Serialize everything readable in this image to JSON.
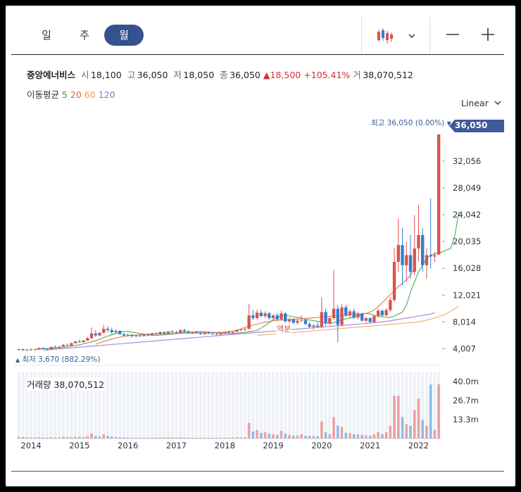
{
  "toolbar": {
    "periods": [
      {
        "label": "일",
        "active": false
      },
      {
        "label": "주",
        "active": false
      },
      {
        "label": "월",
        "active": true
      }
    ],
    "chart_style_icon": "candlestick-icon",
    "dropdown_icon": "chevron-down-icon",
    "zoom_out_label": "—",
    "zoom_in_label": "+"
  },
  "quote": {
    "name": "중앙에너비스",
    "open_label": "시",
    "open": "18,100",
    "high_label": "고",
    "high": "36,050",
    "low_label": "저",
    "low": "18,050",
    "close_label": "종",
    "close": "36,050",
    "change": "▲18,500",
    "change_pct": "+105.41%",
    "volume_label": "거",
    "volume": "38,070,512"
  },
  "ma_legend": {
    "label": "이동평균",
    "items": [
      {
        "period": "5",
        "color": "#2e9e3a"
      },
      {
        "period": "20",
        "color": "#e0603a"
      },
      {
        "period": "60",
        "color": "#e8a050"
      },
      {
        "period": "120",
        "color": "#9a6ad0"
      }
    ]
  },
  "scale": {
    "label": "Linear",
    "icon": "chevron-down-icon"
  },
  "annotations": {
    "high_marker": "최고 36,050 (0.00%)",
    "low_marker": "최저 3,670 (882.29%)",
    "current_price": "36,050",
    "event_label": "액분"
  },
  "volume_panel": {
    "label": "거래량 38,070,512"
  },
  "colors": {
    "up": "#d9534f",
    "down": "#2f7fd1",
    "accent": "#3f5a9a",
    "vol_up": "#eaa3a3",
    "vol_down": "#8fbce6"
  },
  "chart_data": {
    "type": "candlestick",
    "y_ticks": [
      "36,050",
      "32,056",
      "28,049",
      "24,042",
      "20,035",
      "16,028",
      "12,021",
      "8,014",
      "4,007"
    ],
    "ylim": [
      2700,
      37400
    ],
    "x_ticks": [
      "2014",
      "2015",
      "2016",
      "2017",
      "2018",
      "2019",
      "2020",
      "2021",
      "2022"
    ],
    "x_tick_pos": [
      3.5,
      15.5,
      27.5,
      39.5,
      51.5,
      63.5,
      75.5,
      87.5,
      99.5
    ],
    "volume_ticks": [
      "40.0m",
      "26.7m",
      "13.3m"
    ],
    "volume_max": 47000000,
    "candles": [
      [
        3900,
        4050,
        3700,
        3950,
        1200000
      ],
      [
        3950,
        4000,
        3700,
        3800,
        900000
      ],
      [
        3800,
        4000,
        3670,
        3900,
        800000
      ],
      [
        3900,
        4100,
        3800,
        3850,
        700000
      ],
      [
        3850,
        4000,
        3750,
        3950,
        600000
      ],
      [
        3950,
        4200,
        3900,
        4150,
        900000
      ],
      [
        4150,
        4200,
        3950,
        4000,
        700000
      ],
      [
        4000,
        4100,
        3850,
        3950,
        500000
      ],
      [
        3950,
        4350,
        3900,
        4300,
        900000
      ],
      [
        4300,
        4500,
        4200,
        4250,
        800000
      ],
      [
        4250,
        4400,
        4100,
        4350,
        700000
      ],
      [
        4350,
        4700,
        4300,
        4600,
        1200000
      ],
      [
        4600,
        4800,
        4450,
        4500,
        900000
      ],
      [
        4500,
        4900,
        4450,
        4850,
        1100000
      ],
      [
        4850,
        5200,
        4800,
        5100,
        1300000
      ],
      [
        5100,
        5400,
        4900,
        5000,
        1200000
      ],
      [
        5000,
        5300,
        4950,
        5250,
        1000000
      ],
      [
        5250,
        5800,
        5200,
        5600,
        1800000
      ],
      [
        5600,
        7200,
        5500,
        6300,
        3500000
      ],
      [
        6300,
        6800,
        5800,
        6000,
        1800000
      ],
      [
        6000,
        6500,
        5900,
        6400,
        1500000
      ],
      [
        6400,
        7600,
        6300,
        7000,
        2800000
      ],
      [
        7000,
        7400,
        6500,
        6800,
        1900000
      ],
      [
        6800,
        7200,
        6200,
        6500,
        1400000
      ],
      [
        6500,
        6900,
        6300,
        6700,
        1000000
      ],
      [
        6700,
        6800,
        6100,
        6200,
        900000
      ],
      [
        6200,
        6400,
        5900,
        6000,
        700000
      ],
      [
        6000,
        6300,
        5800,
        6100,
        600000
      ],
      [
        6100,
        6200,
        5700,
        5900,
        600000
      ],
      [
        5900,
        6100,
        5700,
        6000,
        500000
      ],
      [
        6000,
        6200,
        5800,
        5900,
        500000
      ],
      [
        5900,
        6200,
        5850,
        6100,
        600000
      ],
      [
        6100,
        6300,
        5900,
        6000,
        500000
      ],
      [
        6000,
        6400,
        5950,
        6300,
        700000
      ],
      [
        6300,
        6500,
        6100,
        6200,
        600000
      ],
      [
        6200,
        6600,
        6150,
        6500,
        800000
      ],
      [
        6500,
        6600,
        6200,
        6300,
        700000
      ],
      [
        6300,
        6700,
        6250,
        6600,
        800000
      ],
      [
        6600,
        6800,
        6400,
        6500,
        700000
      ],
      [
        6500,
        6700,
        6300,
        6400,
        600000
      ],
      [
        6400,
        6900,
        6350,
        6800,
        900000
      ],
      [
        6800,
        7000,
        6500,
        6600,
        700000
      ],
      [
        6600,
        6800,
        6300,
        6400,
        600000
      ],
      [
        6400,
        6600,
        6200,
        6500,
        500000
      ],
      [
        6500,
        6700,
        6300,
        6350,
        500000
      ],
      [
        6350,
        6500,
        6100,
        6200,
        500000
      ],
      [
        6200,
        6500,
        6100,
        6400,
        600000
      ],
      [
        6400,
        6600,
        6200,
        6300,
        500000
      ],
      [
        6300,
        6500,
        6100,
        6200,
        500000
      ],
      [
        6200,
        6400,
        6050,
        6150,
        500000
      ],
      [
        6150,
        6400,
        6100,
        6350,
        600000
      ],
      [
        6350,
        6600,
        6200,
        6500,
        700000
      ],
      [
        6500,
        6700,
        6300,
        6400,
        600000
      ],
      [
        6400,
        6600,
        6250,
        6550,
        700000
      ],
      [
        6550,
        6900,
        6500,
        6800,
        900000
      ],
      [
        6800,
        7000,
        6600,
        6900,
        800000
      ],
      [
        6900,
        7100,
        6700,
        7000,
        900000
      ],
      [
        7000,
        10700,
        6900,
        9000,
        11000000
      ],
      [
        9000,
        9800,
        8300,
        8600,
        5000000
      ],
      [
        8600,
        9900,
        8400,
        9400,
        6000000
      ],
      [
        9400,
        9800,
        8700,
        8900,
        4000000
      ],
      [
        8900,
        9600,
        8600,
        9300,
        4500000
      ],
      [
        9300,
        9500,
        8400,
        8600,
        3500000
      ],
      [
        8600,
        9200,
        8300,
        9000,
        3000000
      ],
      [
        9000,
        9300,
        8200,
        8400,
        2500000
      ],
      [
        8400,
        9700,
        8200,
        9300,
        5500000
      ],
      [
        9300,
        9500,
        7900,
        8100,
        3500000
      ],
      [
        8100,
        8700,
        7800,
        8400,
        2500000
      ],
      [
        8400,
        8600,
        7700,
        7900,
        2000000
      ],
      [
        7900,
        8400,
        7600,
        8200,
        2000000
      ],
      [
        8200,
        9000,
        8000,
        8300,
        3000000
      ],
      [
        8300,
        8500,
        7600,
        7700,
        2000000
      ],
      [
        7700,
        8000,
        7100,
        7300,
        1800000
      ],
      [
        7300,
        7700,
        6900,
        7500,
        1800000
      ],
      [
        7500,
        8000,
        7200,
        7300,
        1600000
      ],
      [
        7300,
        11700,
        7100,
        9500,
        12000000
      ],
      [
        9500,
        10000,
        7500,
        7800,
        4500000
      ],
      [
        7800,
        8900,
        7600,
        8600,
        3000000
      ],
      [
        8600,
        15800,
        8300,
        10000,
        15000000
      ],
      [
        10000,
        10500,
        5000,
        7600,
        9000000
      ],
      [
        7600,
        10700,
        7400,
        10200,
        8000000
      ],
      [
        10200,
        10600,
        8800,
        9000,
        4000000
      ],
      [
        9000,
        9900,
        8700,
        9600,
        3500000
      ],
      [
        9600,
        10000,
        8500,
        8700,
        3000000
      ],
      [
        8700,
        9500,
        8400,
        9300,
        2800000
      ],
      [
        9300,
        9400,
        8100,
        8200,
        2500000
      ],
      [
        8200,
        8800,
        7900,
        8600,
        2200000
      ],
      [
        8600,
        8700,
        7800,
        8000,
        2000000
      ],
      [
        8000,
        9000,
        7900,
        8900,
        3000000
      ],
      [
        8900,
        10000,
        8700,
        9700,
        4500000
      ],
      [
        9700,
        9900,
        8800,
        9000,
        3000000
      ],
      [
        9000,
        10100,
        8900,
        9800,
        4500000
      ],
      [
        9800,
        11700,
        9500,
        11300,
        9000000
      ],
      [
        11300,
        19000,
        11000,
        17000,
        30000000
      ],
      [
        17000,
        23500,
        15500,
        19500,
        30000000
      ],
      [
        19500,
        22000,
        13500,
        16500,
        15000000
      ],
      [
        16500,
        20000,
        14000,
        18000,
        10000000
      ],
      [
        18000,
        21000,
        14500,
        15500,
        9000000
      ],
      [
        15500,
        24000,
        15000,
        19000,
        20000000
      ],
      [
        19000,
        25500,
        17000,
        21000,
        28000000
      ],
      [
        21000,
        22000,
        15500,
        16500,
        13000000
      ],
      [
        16500,
        19000,
        14500,
        18000,
        9000000
      ],
      [
        18000,
        26500,
        16000,
        17800,
        38000000
      ],
      [
        17800,
        18500,
        17000,
        18000,
        6000000
      ],
      [
        18100,
        36050,
        18050,
        36050,
        38070512
      ]
    ],
    "moving_averages": [
      {
        "period": "5",
        "color": "#2e9e3a",
        "start": 4,
        "values": [
          3900,
          3950,
          4000,
          4000,
          4050,
          4100,
          4150,
          4250,
          4300,
          4400,
          4500,
          4600,
          4750,
          4900,
          5050,
          5200,
          5400,
          5700,
          5900,
          6100,
          6300,
          6500,
          6600,
          6600,
          6500,
          6400,
          6300,
          6200,
          6100,
          6050,
          6000,
          6050,
          6100,
          6150,
          6200,
          6300,
          6400,
          6450,
          6500,
          6500,
          6550,
          6600,
          6550,
          6500,
          6450,
          6400,
          6350,
          6300,
          6300,
          6300,
          6350,
          6400,
          6450,
          6550,
          6650,
          6750,
          7100,
          7500,
          7900,
          8300,
          8700,
          8900,
          9000,
          8900,
          8800,
          8700,
          8600,
          8400,
          8300,
          8200,
          8100,
          8000,
          7900,
          7800,
          7900,
          8200,
          8300,
          8500,
          8600,
          8700,
          8800,
          9200,
          9300,
          9200,
          9000,
          8900,
          8800,
          8700,
          8700,
          8900,
          9200,
          9500,
          10500,
          12500,
          14000,
          15500,
          16500,
          17500,
          18000,
          18200,
          18300,
          18500,
          18800,
          19000,
          21000,
          24500
        ]
      },
      {
        "period": "20",
        "color": "#e0603a",
        "start": 19,
        "values": [
          4700,
          4900,
          5100,
          5300,
          5450,
          5600,
          5750,
          5850,
          5950,
          6000,
          6050,
          6100,
          6150,
          6200,
          6250,
          6250,
          6250,
          6250,
          6300,
          6300,
          6300,
          6300,
          6350,
          6350,
          6350,
          6400,
          6400,
          6400,
          6400,
          6450,
          6450,
          6500,
          6500,
          6600,
          6700,
          6800,
          7000,
          7200,
          7400,
          7550,
          7700,
          7850,
          8000,
          8100,
          8200,
          8250,
          8300,
          8350,
          8400,
          8450,
          8450,
          8500,
          8550,
          8600,
          8650,
          8700,
          8750,
          8800,
          8850,
          8900,
          8900,
          8950,
          9000,
          9050,
          9100,
          9150,
          9200,
          9300,
          9500,
          9800,
          10300,
          10900,
          11500,
          12100,
          12700,
          13300,
          13800,
          14300,
          15000,
          16000
        ]
      },
      {
        "period": "60",
        "color": "#e8a050",
        "start": 59,
        "values": [
          6000,
          6050,
          6100,
          6150,
          6200,
          6250,
          6300,
          6350,
          6400,
          6450,
          6500,
          6550,
          6600,
          6650,
          6700,
          6750,
          6800,
          6850,
          6900,
          6950,
          7000,
          7050,
          7100,
          7150,
          7200,
          7250,
          7300,
          7350,
          7400,
          7450,
          7500,
          7550,
          7600,
          7650,
          7700,
          7750,
          7800,
          7850,
          7900,
          7950,
          8050,
          8150,
          8300,
          8450,
          8600,
          8800,
          9000,
          9300,
          9600,
          10000,
          10400
        ]
      },
      {
        "period": "120",
        "color": "#9a6ad0",
        "start": 6,
        "values": [
          3800,
          3850,
          3900,
          3950,
          4000,
          4050,
          4100,
          4150,
          4200,
          4250,
          4300,
          4350,
          4400,
          4450,
          4500,
          4550,
          4600,
          4650,
          4700,
          4750,
          4800,
          4850,
          4900,
          4950,
          5000,
          5050,
          5100,
          5150,
          5200,
          5250,
          5300,
          5350,
          5400,
          5450,
          5500,
          5550,
          5600,
          5650,
          5700,
          5750,
          5800,
          5850,
          5900,
          5950,
          6000,
          6050,
          6100,
          6150,
          6200,
          6250,
          6300,
          6350,
          6400,
          6450,
          6500,
          6550,
          6600,
          6650,
          6700,
          6750,
          6800,
          6850,
          6900,
          6950,
          7000,
          7050,
          7100,
          7150,
          7200,
          7250,
          7300,
          7350,
          7400,
          7450,
          7500,
          7550,
          7600,
          7650,
          7700,
          7750,
          7800,
          7850,
          7900,
          7950,
          8000,
          8100,
          8200,
          8300,
          8400,
          8500,
          8600,
          8700,
          8800,
          8900,
          9000,
          9100,
          9200,
          9400
        ]
      }
    ]
  }
}
